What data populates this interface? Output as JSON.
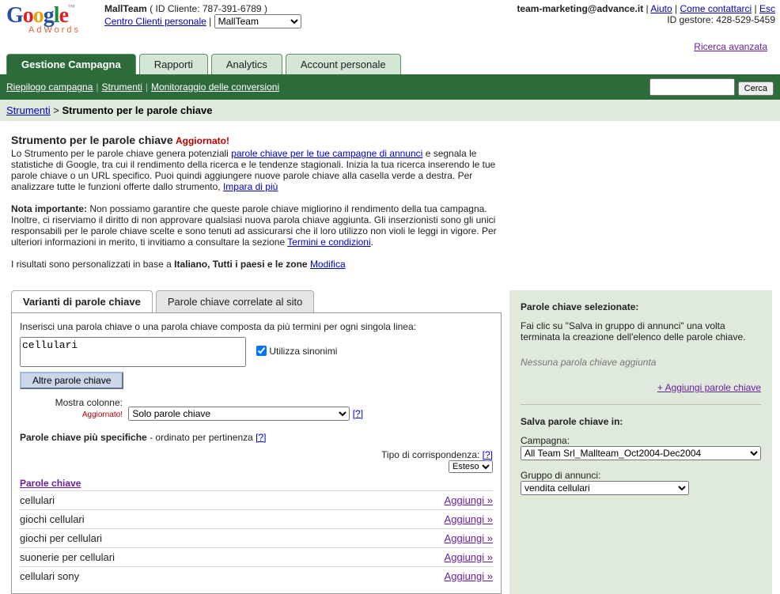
{
  "header": {
    "brand": "Google",
    "brand_sub": "AdWords",
    "account_name": "MallTeam",
    "client_id_label": "( ID Cliente: 787-391-6789 )",
    "personal_center": "Centro Clienti personale",
    "selector_value": "MallTeam",
    "email": "team-marketing@advance.it",
    "help": "Aiuto",
    "contact": "Come contattarci",
    "exit": "Esc",
    "manager_id": "ID gestore: 428-529-5459"
  },
  "tabs": {
    "campaign": "Gestione Campagna",
    "reports": "Rapporti",
    "analytics": "Analytics",
    "account": "Account personale"
  },
  "subnav": {
    "summary": "Riepilogo campagna",
    "tools": "Strumenti",
    "conversions": "Monitoraggio delle conversioni",
    "search_btn": "Cerca",
    "adv_search": "Ricerca avanzata"
  },
  "crumbs": {
    "tools": "Strumenti",
    "sep": " > ",
    "current": "Strumento per le parole chiave"
  },
  "content": {
    "title": "Strumento per le parole chiave",
    "updated": "Aggiornato!",
    "intro_a": "Lo Strumento per le parole chiave genera potenziali ",
    "intro_link": "parole chiave per le tue campagne di annunci",
    "intro_b": " e segnala le statistiche di Google, tra cui il rendimento della ricerca e le tendenze stagionali. Inizia la tua ricerca inserendo le tue parole chiave o un URL specifico. Puoi quindi aggiungere nuove parole chiave alla casella verde a destra. Per analizzare tutte le funzioni offerte dallo strumento, ",
    "learn_more": "Impara di più",
    "note_label": "Nota importante:",
    "note_body": " Non possiamo garantire che queste parole chiave migliorino il rendimento della tua campagna. Inoltre, ci riserviamo il diritto di non approvare qualsiasi nuova parola chiave aggiunta. Gli inserzionisti sono gli unici responsabili per le parole chiave scelte e sono tenuti ad assicurarsi che il loro utilizzo non violi le leggi in vigore. Per ulteriori informazioni in merito, ti invitiamo a consultare la sezione ",
    "terms_link": "Termini e condizioni",
    "pers_a": "I risultati sono personalizzati in base a ",
    "pers_bold": "Italiano, Tutti i paesi e le zone",
    "modify": "Modifica"
  },
  "inner_tabs": {
    "variants": "Varianti di parole chiave",
    "related": "Parole chiave correlate al sito"
  },
  "form": {
    "intro": "Inserisci una parola chiave o una parola chiave composta da più termini per ogni singola linea:",
    "keyword_value": "cellulari",
    "use_syn": "Utilizza sinonimi",
    "more_btn": "Altre parole chiave",
    "show_cols_label": "Mostra colonne:",
    "show_cols_updated": "Aggiornato!",
    "show_cols_value": "Solo parole chiave",
    "q": "[?]",
    "specific_a": "Parole chiave più specifiche",
    "specific_b": " - ordinato per pertinenza ",
    "match_label": "Tipo di corrispondenza: ",
    "match_value": "Esteso",
    "col_keywords": "Parole chiave",
    "add": "Aggiungi »",
    "rows": [
      "cellulari",
      "giochi cellulari",
      "giochi per cellulari",
      "suonerie per cellulari",
      "cellulari sony"
    ]
  },
  "side": {
    "selected_title": "Parole chiave selezionate:",
    "selected_tip": "Fai clic su \"Salva in gruppo di annunci\" una volta terminata la creazione dell'elenco delle parole chiave.",
    "none_added": "Nessuna parola chiave aggiunta",
    "add_keywords": "+ Aggiungi parole chiave",
    "save_title": "Salva parole chiave in:",
    "campaign_label": "Campagna:",
    "campaign_value": "All Team Srl_Mallteam_Oct2004-Dec2004",
    "group_label": "Gruppo di annunci:",
    "group_value": "vendita cellulari"
  }
}
